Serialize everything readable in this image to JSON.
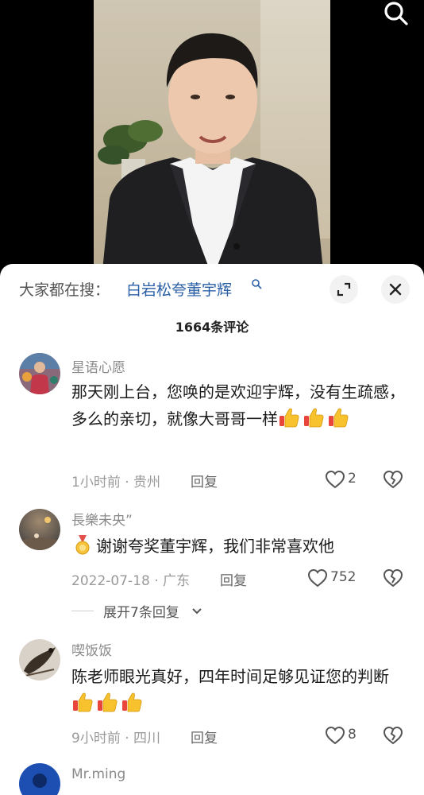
{
  "search_prompt": "大家都在搜：",
  "search_term": "白岩松夸董宇辉",
  "comment_count_title": "1664条评论",
  "comments": [
    {
      "username": "星语心愿",
      "text": "那天刚上台，您唤的是欢迎宇辉，没有生疏感，多么的亲切，就像大哥哥一样",
      "time": "1小时前",
      "location": "贵州",
      "reply_label": "回复",
      "likes": "2"
    },
    {
      "username": "長樂未央”",
      "text": "谢谢夸奖董宇辉，我们非常喜欢他",
      "time": "2022-07-18",
      "location": "广东",
      "reply_label": "回复",
      "likes": "752",
      "expand_replies_label": "展开7条回复"
    },
    {
      "username": "喫饭饭",
      "text": "陈老师眼光真好，四年时间足够见证您的判断",
      "time": "9小时前",
      "location": "四川",
      "reply_label": "回复",
      "likes": "8"
    },
    {
      "username": "Mr.ming"
    }
  ],
  "icons": {
    "search": "search-icon",
    "expand": "expand-icon",
    "close": "close-icon",
    "like": "heart-icon",
    "dislike": "broken-heart-icon",
    "thumbs_up": "thumbs-up-emoji",
    "medal": "medal-emoji"
  },
  "colors": {
    "search_term": "#2a5fa5",
    "meta": "#9a9a9a",
    "username": "#8a8a8a"
  }
}
